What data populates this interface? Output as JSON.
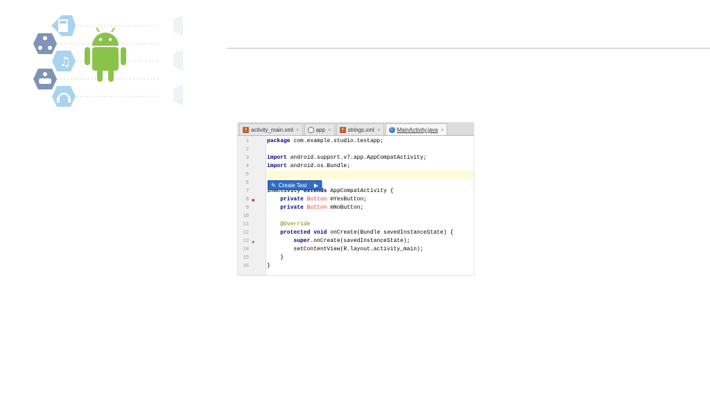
{
  "tabs": [
    {
      "label": "activity_main.xml",
      "icon": "xml-file-icon",
      "active": false
    },
    {
      "label": "app",
      "icon": "module-icon",
      "active": false
    },
    {
      "label": "strings.xml",
      "icon": "xml-file-icon",
      "active": false
    },
    {
      "label": "MainActivity.java",
      "icon": "class-file-icon",
      "active": true
    }
  ],
  "close_symbol": "×",
  "code_lines": [
    {
      "n": "1",
      "text": "package com.example.studio.testapp;"
    },
    {
      "n": "2",
      "text": ""
    },
    {
      "n": "3",
      "text": "import android.support.v7.app.AppCompatActivity;"
    },
    {
      "n": "4",
      "text": "import android.os.Bundle;"
    },
    {
      "n": "5",
      "text": ""
    },
    {
      "n": "6",
      "text": ""
    },
    {
      "n": "7",
      "text": "inActivity extends AppCompatActivity {"
    },
    {
      "n": "8",
      "text": "    private Button mYesButton;"
    },
    {
      "n": "9",
      "text": "    private Button mNoButton;"
    },
    {
      "n": "10",
      "text": ""
    },
    {
      "n": "11",
      "text": "    @Override"
    },
    {
      "n": "12",
      "text": "    protected void onCreate(Bundle savedInstanceState) {"
    },
    {
      "n": "13",
      "text": "        super.onCreate(savedInstanceState);"
    },
    {
      "n": "14",
      "text": "        setContentView(R.layout.activity_main);"
    },
    {
      "n": "15",
      "text": "    }"
    },
    {
      "n": "16",
      "text": "}"
    }
  ],
  "popup": {
    "label": "Create Test"
  },
  "colors": {
    "accent": "#2d6fc6",
    "android_green": "#8bc34a",
    "hex_blue": "#a9d3ee"
  },
  "decor_icons": [
    "calculator-icon",
    "people-network-icon",
    "music-note-icon",
    "group-icon",
    "headphones-icon",
    "android-logo-icon"
  ]
}
